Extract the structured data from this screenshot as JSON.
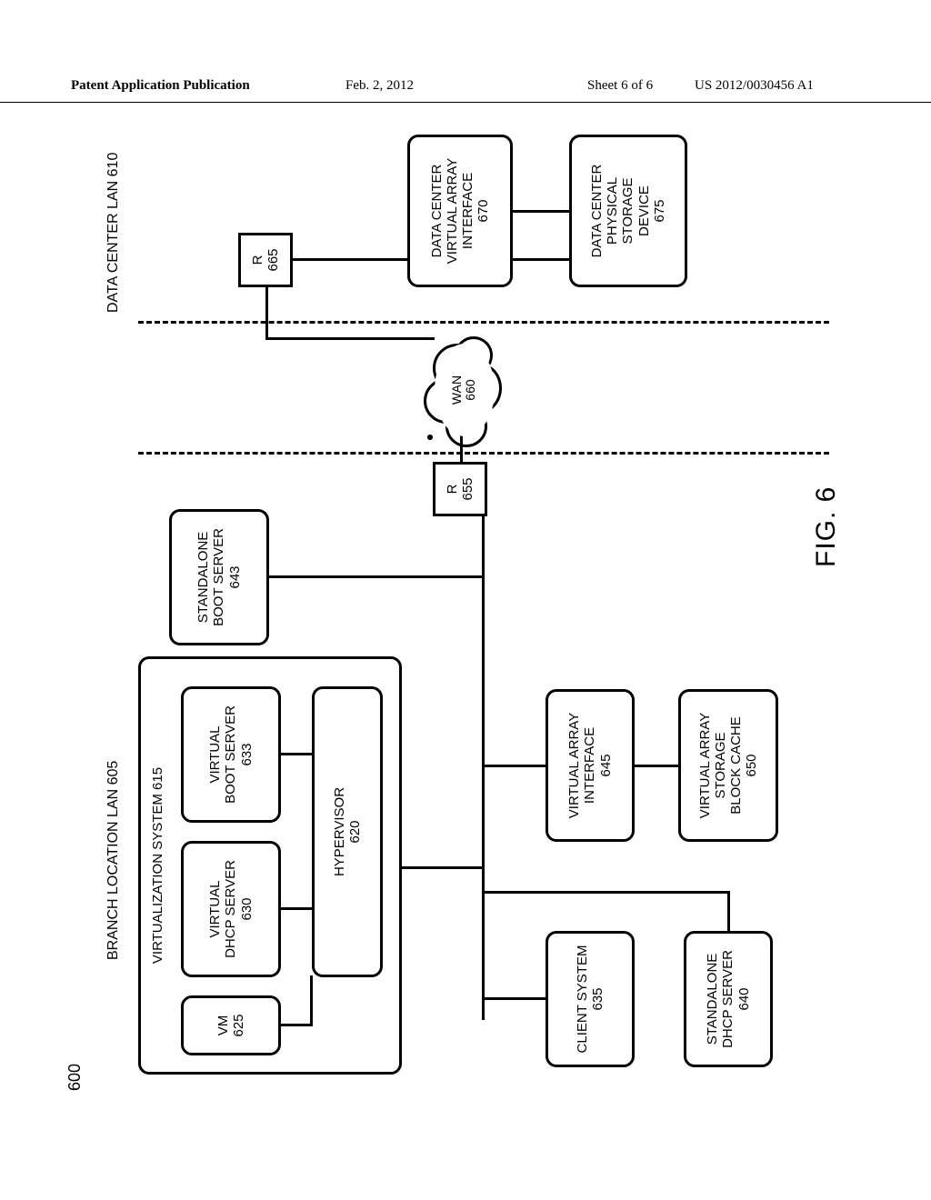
{
  "header": {
    "left": "Patent Application Publication",
    "mid": "Feb. 2, 2012",
    "sheet": "Sheet 6 of 6",
    "pubno": "US 2012/0030456 A1"
  },
  "labels": {
    "fignum": "600",
    "branch_lan": "BRANCH LOCATION LAN 605",
    "datacenter_lan": "DATA CENTER LAN 610",
    "figcaption": "FIG. 6"
  },
  "blocks": {
    "vsys": {
      "line1": "VIRTUALIZATION SYSTEM 615"
    },
    "vm": {
      "line1": "VM",
      "line2": "625"
    },
    "vdhcp": {
      "line1": "VIRTUAL",
      "line2": "DHCP SERVER",
      "line3": "630"
    },
    "vboot": {
      "line1": "VIRTUAL",
      "line2": "BOOT SERVER",
      "line3": "633"
    },
    "hyper": {
      "line1": "HYPERVISOR",
      "line2": "620"
    },
    "stdboot": {
      "line1": "STANDALONE",
      "line2": "BOOT SERVER",
      "line3": "643"
    },
    "client": {
      "line1": "CLIENT SYSTEM",
      "line2": "635"
    },
    "stddhcp": {
      "line1": "STANDALONE",
      "line2": "DHCP SERVER",
      "line3": "640"
    },
    "vai": {
      "line1": "VIRTUAL ARRAY",
      "line2": "INTERFACE",
      "line3": "645"
    },
    "vcache": {
      "line1": "VIRTUAL ARRAY",
      "line2": "STORAGE",
      "line3": "BLOCK CACHE",
      "line4": "650"
    },
    "r655": {
      "line1": "R",
      "line2": "655"
    },
    "r665": {
      "line1": "R",
      "line2": "665"
    },
    "dc_vai": {
      "line1": "DATA CENTER",
      "line2": "VIRTUAL ARRAY",
      "line3": "INTERFACE",
      "line4": "670"
    },
    "dc_phys": {
      "line1": "DATA CENTER",
      "line2": "PHYSICAL",
      "line3": "STORAGE",
      "line4": "DEVICE",
      "line5": "675"
    },
    "wan": {
      "line1": "WAN",
      "line2": "660"
    }
  }
}
